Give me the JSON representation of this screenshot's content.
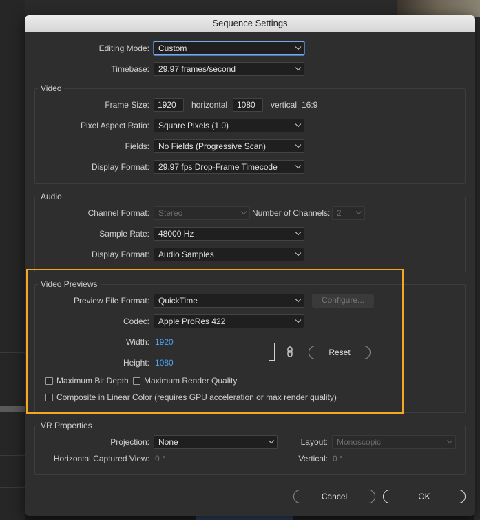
{
  "dialog": {
    "title": "Sequence Settings"
  },
  "general": {
    "editing_mode_label": "Editing Mode:",
    "editing_mode_value": "Custom",
    "timebase_label": "Timebase:",
    "timebase_value": "29.97  frames/second"
  },
  "video": {
    "section_title": "Video",
    "frame_size_label": "Frame Size:",
    "width_value": "1920",
    "horizontal_label": "horizontal",
    "height_value": "1080",
    "vertical_label": "vertical",
    "aspect": "16:9",
    "pixel_aspect_label": "Pixel Aspect Ratio:",
    "pixel_aspect_value": "Square Pixels (1.0)",
    "fields_label": "Fields:",
    "fields_value": "No Fields (Progressive Scan)",
    "display_format_label": "Display Format:",
    "display_format_value": "29.97 fps Drop-Frame Timecode"
  },
  "audio": {
    "section_title": "Audio",
    "channel_format_label": "Channel Format:",
    "channel_format_value": "Stereo",
    "num_channels_label": "Number of Channels:",
    "num_channels_value": "2",
    "sample_rate_label": "Sample Rate:",
    "sample_rate_value": "48000 Hz",
    "display_format_label": "Display Format:",
    "display_format_value": "Audio Samples"
  },
  "previews": {
    "section_title": "Video Previews",
    "preview_format_label": "Preview File Format:",
    "preview_format_value": "QuickTime",
    "configure_label": "Configure...",
    "codec_label": "Codec:",
    "codec_value": "Apple ProRes 422",
    "width_label": "Width:",
    "width_value": "1920",
    "height_label": "Height:",
    "height_value": "1080",
    "reset_label": "Reset",
    "max_bit_depth_label": "Maximum Bit Depth",
    "max_render_quality_label": "Maximum Render Quality",
    "linear_color_label": "Composite in Linear Color (requires GPU acceleration or max render quality)"
  },
  "vr": {
    "section_title": "VR Properties",
    "projection_label": "Projection:",
    "projection_value": "None",
    "layout_label": "Layout:",
    "layout_value": "Monoscopic",
    "hview_label": "Horizontal Captured View:",
    "hview_value": "0 °",
    "vertical_label": "Vertical:",
    "vertical_value": "0 °"
  },
  "footer": {
    "cancel_label": "Cancel",
    "ok_label": "OK"
  },
  "colors": {
    "highlight": "#f5a623",
    "value_blue": "#4ca3f2"
  },
  "icons": [
    "chevron-down-icon",
    "link-icon",
    "checkbox-icon"
  ]
}
